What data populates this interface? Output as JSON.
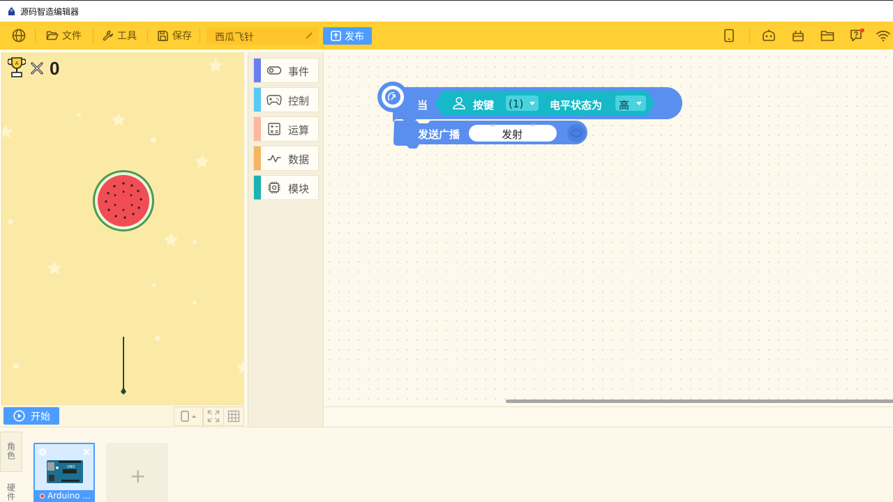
{
  "window": {
    "title": "源码智造编辑器"
  },
  "toolbar": {
    "file_label": "文件",
    "tools_label": "工具",
    "save_label": "保存",
    "project_name": "西瓜飞针",
    "publish_label": "发布"
  },
  "stage": {
    "score": "0",
    "start_label": "开始"
  },
  "palette": {
    "categories": [
      {
        "label": "事件",
        "color": "#6b7ff0",
        "icon": "toggle-icon"
      },
      {
        "label": "控制",
        "color": "#5ac8f5",
        "icon": "gamepad-icon"
      },
      {
        "label": "运算",
        "color": "#ffb8a0",
        "icon": "calculator-icon"
      },
      {
        "label": "数据",
        "color": "#f7b561",
        "icon": "chart-line-icon"
      },
      {
        "label": "模块",
        "color": "#1bb3b3",
        "icon": "chip-icon"
      }
    ]
  },
  "blocks": {
    "when_label": "当",
    "button_label": "按键",
    "button_value": "(1)",
    "level_label": "电平状态为",
    "level_value": "高",
    "broadcast_label": "发送广播",
    "broadcast_value": "发射"
  },
  "bottom": {
    "role_tab": "角色",
    "hardware_tab": "硬件",
    "sprite_name": "Arduino ...",
    "add_label": "+"
  },
  "colors": {
    "toolbar": "#ffcf33",
    "accent_blue": "#4d9cff",
    "event_block": "#5a8ff0",
    "sensor_block": "#17b8c8",
    "stage_bg": "#fbeaa6"
  }
}
